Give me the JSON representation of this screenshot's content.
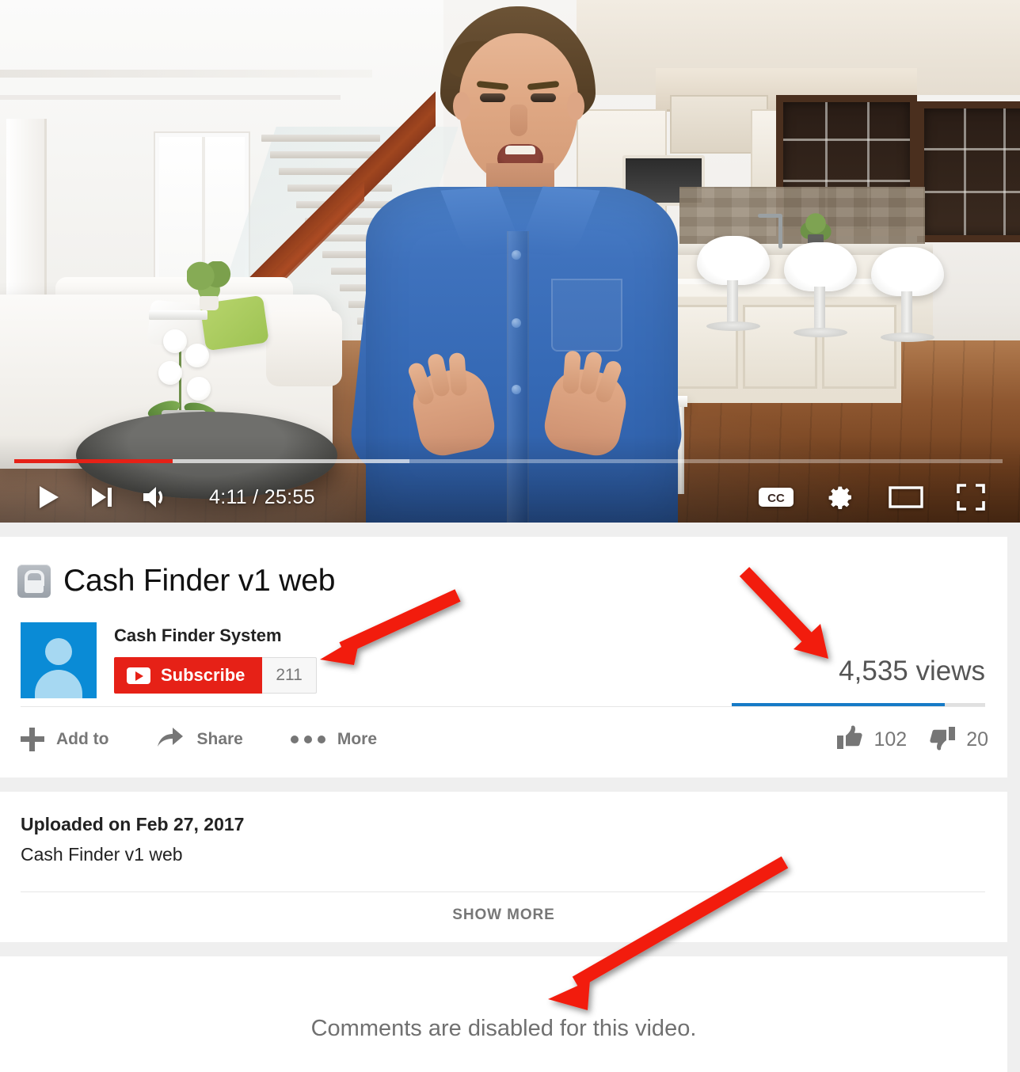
{
  "player": {
    "current_time": "4:11",
    "total_time": "25:55",
    "time_display": "4:11 / 25:55",
    "progress_percent": 16,
    "loaded_percent": 40,
    "controls": {
      "play": "Play",
      "next": "Next video",
      "volume": "Volume",
      "captions": "CC",
      "settings": "Settings",
      "theater": "Theater mode",
      "fullscreen": "Full screen"
    }
  },
  "video": {
    "title": "Cash Finder v1 web",
    "privacy_icon": "unlisted-lock-icon",
    "channel_name": "Cash Finder System",
    "subscribe_label": "Subscribe",
    "subscriber_count": "211",
    "views": "4,535 views",
    "likes": "102",
    "dislikes": "20",
    "like_ratio_percent": 84
  },
  "actions": [
    {
      "label": "Add to",
      "icon": "plus-icon"
    },
    {
      "label": "Share",
      "icon": "share-arrow-icon"
    },
    {
      "label": "More",
      "icon": "three-dots-icon"
    }
  ],
  "description": {
    "upload_date": "Uploaded on Feb 27, 2017",
    "text": "Cash Finder v1 web",
    "show_more_label": "SHOW MORE"
  },
  "comments": {
    "message": "Comments are disabled for this video."
  },
  "colors": {
    "brand_red": "#e62117",
    "annotation_red": "#f21d0d",
    "like_bar_blue": "#167ac6",
    "avatar_blue": "#0a8bd6",
    "text_grey": "#767676"
  },
  "annotations": [
    {
      "name": "arrow-to-subscriber-count",
      "target": "subscriber_count"
    },
    {
      "name": "arrow-to-view-count",
      "target": "views"
    },
    {
      "name": "arrow-to-comments-disabled",
      "target": "comments_message"
    }
  ]
}
